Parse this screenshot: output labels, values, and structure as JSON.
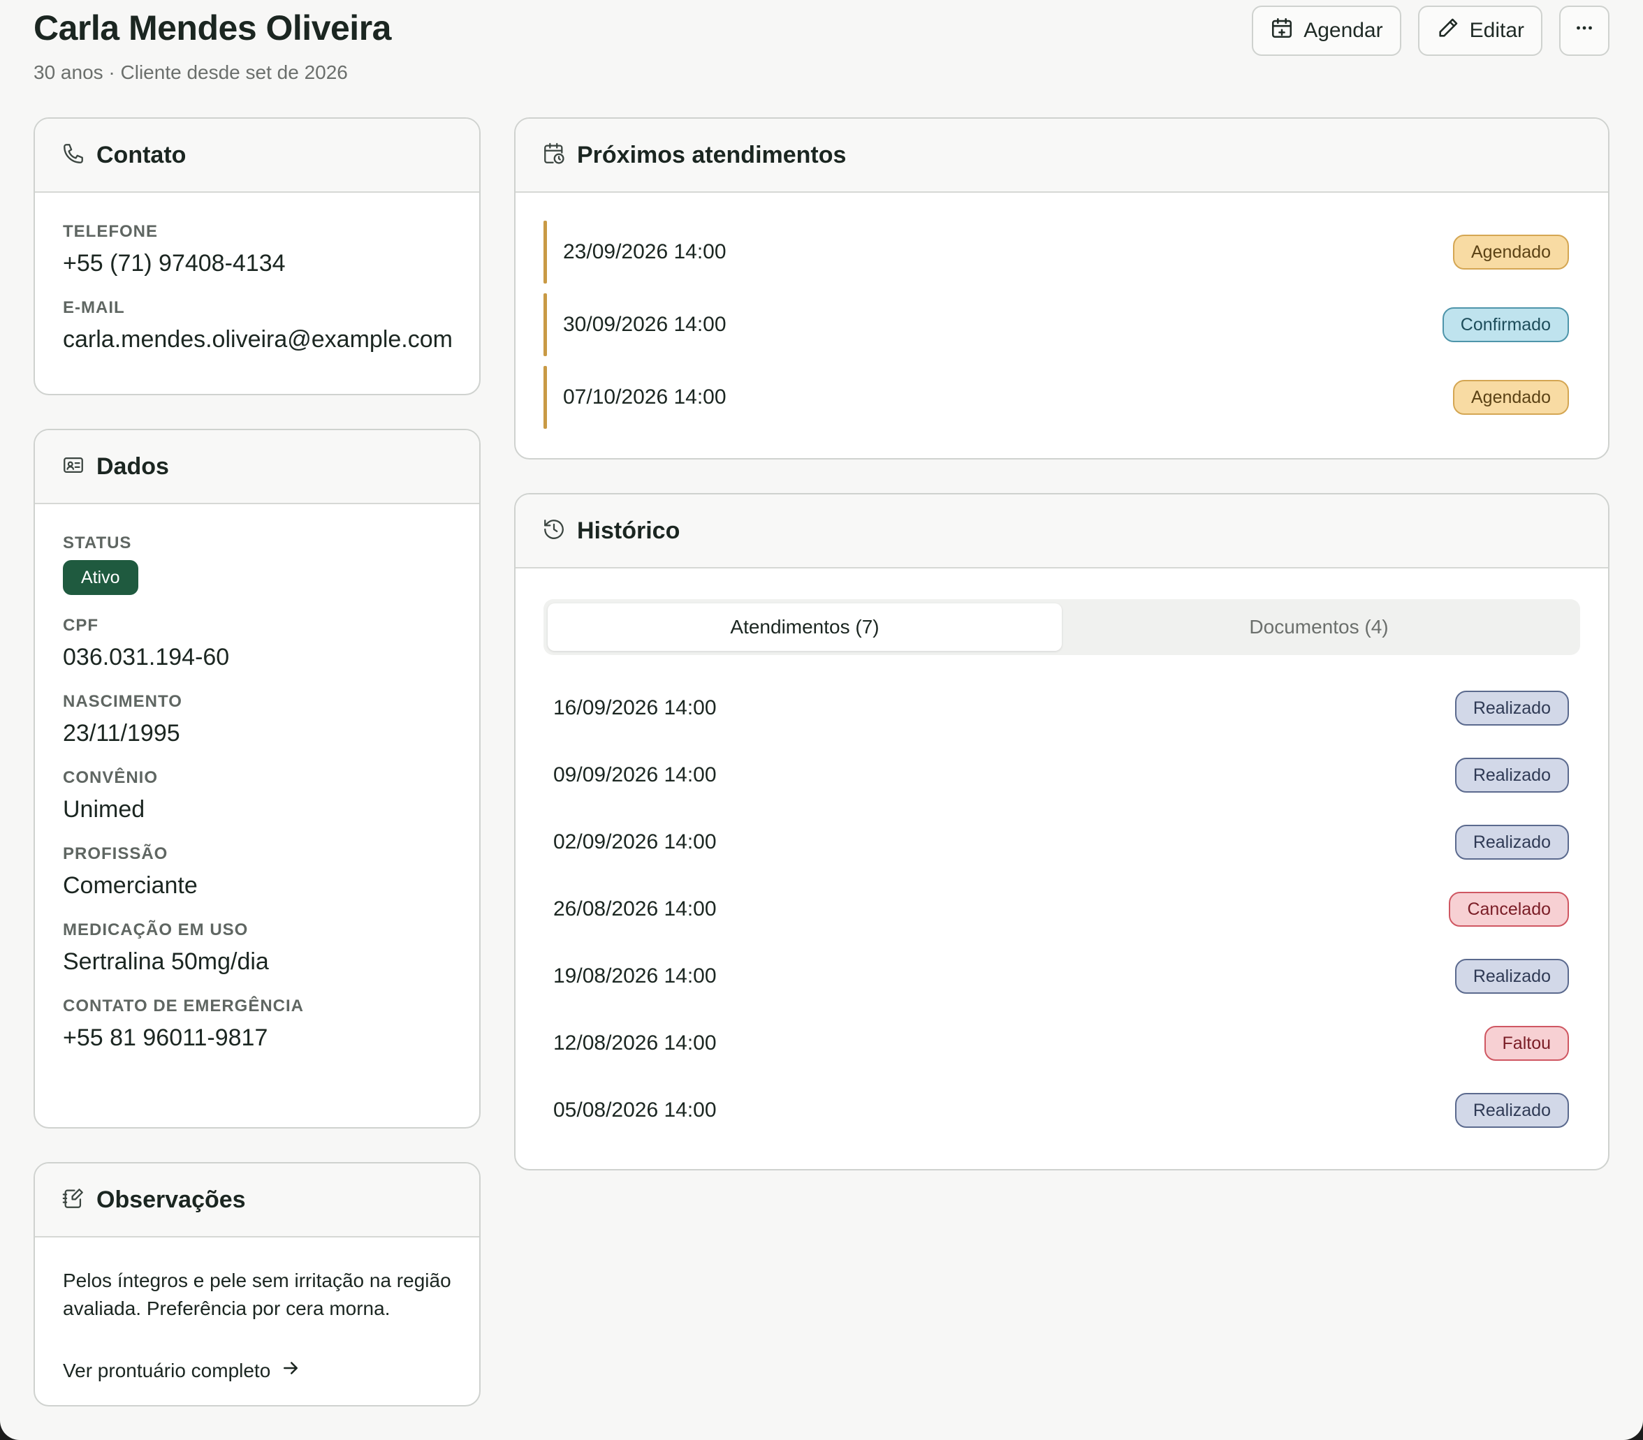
{
  "header": {
    "name": "Carla Mendes Oliveira",
    "subtitle": "30 anos · Cliente desde set de 2026",
    "schedule_label": "Agendar",
    "edit_label": "Editar"
  },
  "contact": {
    "title": "Contato",
    "phone_label": "TELEFONE",
    "phone": "+55 (71) 97408-4134",
    "email_label": "E-MAIL",
    "email": "carla.mendes.oliveira@example.com"
  },
  "details": {
    "title": "Dados",
    "status_label": "STATUS",
    "status": "Ativo",
    "cpf_label": "CPF",
    "cpf": "036.031.194-60",
    "birth_label": "NASCIMENTO",
    "birth": "23/11/1995",
    "insurance_label": "CONVÊNIO",
    "insurance": "Unimed",
    "job_label": "PROFISSÃO",
    "job": "Comerciante",
    "meds_label": "MEDICAÇÃO EM USO",
    "meds": "Sertralina 50mg/dia",
    "emergency_label": "CONTATO DE EMERGÊNCIA",
    "emergency": "+55 81 96011-9817"
  },
  "notes": {
    "title": "Observações",
    "text": "Pelos íntegros e pele sem irritação na região avaliada. Preferência por cera morna.",
    "link": "Ver prontuário completo"
  },
  "upcoming": {
    "title": "Próximos atendimentos",
    "items": [
      {
        "date": "23/09/2026 14:00",
        "status": "Agendado"
      },
      {
        "date": "30/09/2026 14:00",
        "status": "Confirmado"
      },
      {
        "date": "07/10/2026 14:00",
        "status": "Agendado"
      }
    ]
  },
  "history": {
    "title": "Histórico",
    "tabs": [
      "Atendimentos (7)",
      "Documentos (4)"
    ],
    "items": [
      {
        "date": "16/09/2026 14:00",
        "status": "Realizado"
      },
      {
        "date": "09/09/2026 14:00",
        "status": "Realizado"
      },
      {
        "date": "02/09/2026 14:00",
        "status": "Realizado"
      },
      {
        "date": "26/08/2026 14:00",
        "status": "Cancelado"
      },
      {
        "date": "19/08/2026 14:00",
        "status": "Realizado"
      },
      {
        "date": "12/08/2026 14:00",
        "status": "Faltou"
      },
      {
        "date": "05/08/2026 14:00",
        "status": "Realizado"
      }
    ]
  },
  "colors": {
    "status_active": "#1f5a3f",
    "agendado": "#f8dba3",
    "confirmado": "#bfe3ee",
    "realizado": "#d2d8e8",
    "cancelado": "#f7d0d3",
    "upcoming_bar": "#c99a45"
  }
}
